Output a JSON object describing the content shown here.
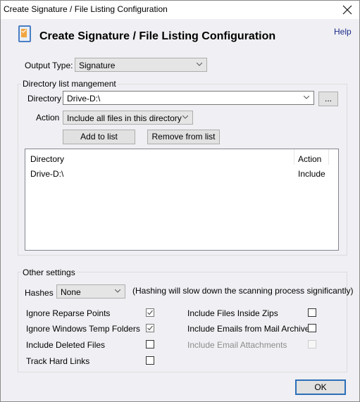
{
  "window": {
    "title": "Create Signature / File Listing Configuration",
    "close_icon": "close-icon"
  },
  "header": {
    "title": "Create Signature / File Listing Configuration",
    "help_label": "Help",
    "icon": "signature-document-icon"
  },
  "output_type": {
    "label": "Output Type:",
    "value": "Signature"
  },
  "directory_group": {
    "title": "Directory list mangement",
    "directory_label": "Directory",
    "directory_value": "Drive-D:\\",
    "browse_label": "...",
    "action_label": "Action",
    "action_value": "Include all files in this directory",
    "add_label": "Add to list",
    "remove_label": "Remove from list",
    "list": {
      "columns": [
        "Directory",
        "Action"
      ],
      "rows": [
        {
          "directory": "Drive-D:\\",
          "action": "Include"
        }
      ]
    }
  },
  "other_settings": {
    "title": "Other settings",
    "hashes_label": "Hashes",
    "hashes_value": "None",
    "hashes_note": "(Hashing will slow down the scanning process significantly)",
    "options_left": [
      {
        "label": "Ignore Reparse Points",
        "checked": true,
        "enabled": true
      },
      {
        "label": "Ignore Windows Temp Folders",
        "checked": true,
        "enabled": true
      },
      {
        "label": "Include Deleted Files",
        "checked": false,
        "enabled": true
      },
      {
        "label": "Track Hard Links",
        "checked": false,
        "enabled": true
      }
    ],
    "options_right": [
      {
        "label": "Include Files Inside Zips",
        "checked": false,
        "enabled": true
      },
      {
        "label": "Include Emails from Mail Archives",
        "checked": false,
        "enabled": true
      },
      {
        "label": "Include Email Attachments",
        "checked": false,
        "enabled": false
      }
    ]
  },
  "footer": {
    "ok_label": "OK"
  },
  "colors": {
    "accent": "#2b6fb8",
    "help_link": "#1a2c8a",
    "background": "#f0eff3"
  }
}
